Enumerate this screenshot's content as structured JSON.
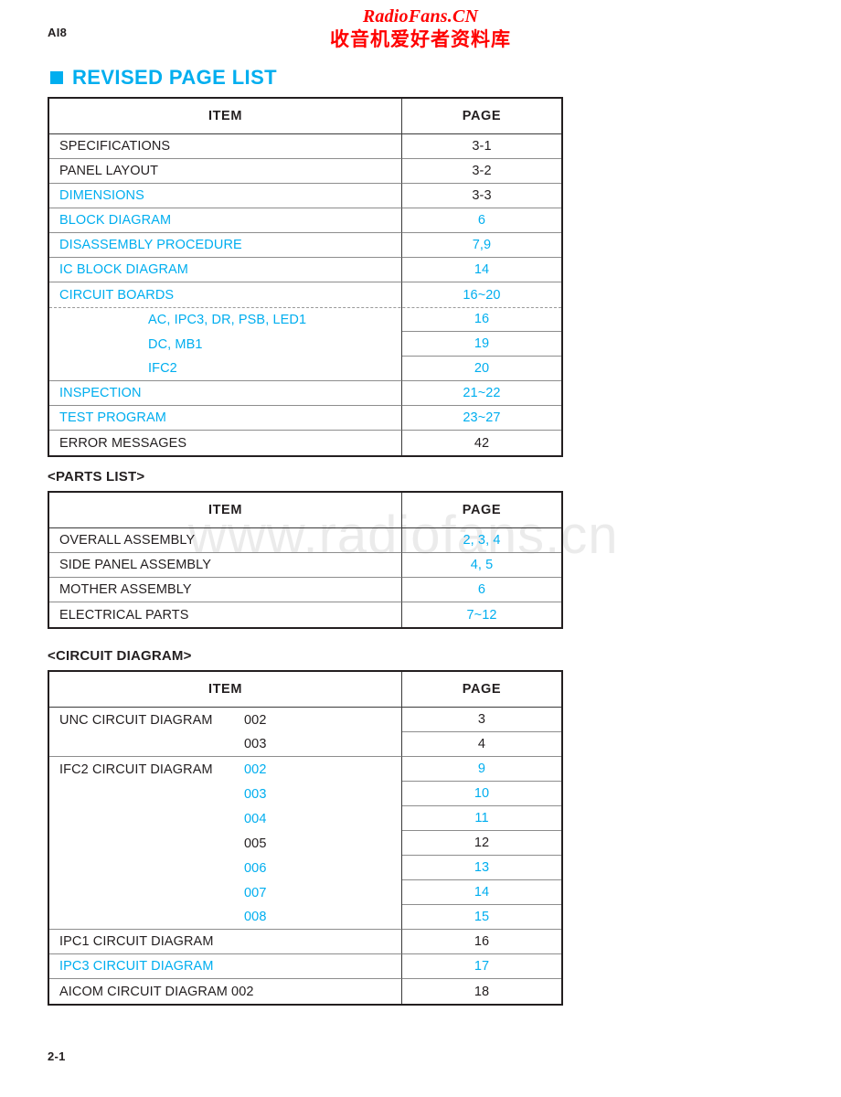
{
  "header": {
    "model_code": "AI8",
    "watermark_latin": "RadioFans.CN",
    "watermark_cjk": "收音机爱好者资料库",
    "body_watermark": "www.radiofans.cn"
  },
  "section": {
    "title": "REVISED PAGE LIST",
    "accent_color": "#00AEEF"
  },
  "footer": {
    "page_number": "2-1"
  },
  "revised_page_list": {
    "columns": [
      "ITEM",
      "PAGE"
    ],
    "rows": [
      {
        "item": "SPECIFICATIONS",
        "page": "3-1",
        "item_color": "black",
        "page_color": "black",
        "indent": false,
        "sep": "full"
      },
      {
        "item": "PANEL LAYOUT",
        "page": "3-2",
        "item_color": "black",
        "page_color": "black",
        "indent": false,
        "sep": "full"
      },
      {
        "item": "DIMENSIONS",
        "page": "3-3",
        "item_color": "blue",
        "page_color": "black",
        "indent": false,
        "sep": "full"
      },
      {
        "item": "BLOCK DIAGRAM",
        "page": "6",
        "item_color": "blue",
        "page_color": "blue",
        "indent": false,
        "sep": "full"
      },
      {
        "item": "DISASSEMBLY PROCEDURE",
        "page": "7,9",
        "item_color": "blue",
        "page_color": "blue",
        "indent": false,
        "sep": "full"
      },
      {
        "item": "IC BLOCK DIAGRAM",
        "page": "14",
        "item_color": "blue",
        "page_color": "blue",
        "indent": false,
        "sep": "full"
      },
      {
        "item": "CIRCUIT BOARDS",
        "page": "16~20",
        "item_color": "blue",
        "page_color": "blue",
        "indent": false,
        "sep": "dashed"
      },
      {
        "item": "AC, IPC3, DR, PSB, LED1",
        "page": "16",
        "item_color": "blue",
        "page_color": "blue",
        "indent": true,
        "sep": "page-only"
      },
      {
        "item": "DC, MB1",
        "page": "19",
        "item_color": "blue",
        "page_color": "blue",
        "indent": true,
        "sep": "page-only"
      },
      {
        "item": "IFC2",
        "page": "20",
        "item_color": "blue",
        "page_color": "blue",
        "indent": true,
        "sep": "full"
      },
      {
        "item": "INSPECTION",
        "page": "21~22",
        "item_color": "blue",
        "page_color": "blue",
        "indent": false,
        "sep": "full"
      },
      {
        "item": "TEST PROGRAM",
        "page": "23~27",
        "item_color": "blue",
        "page_color": "blue",
        "indent": false,
        "sep": "full"
      },
      {
        "item": "ERROR MESSAGES",
        "page": "42",
        "item_color": "black",
        "page_color": "black",
        "indent": false,
        "sep": "none"
      }
    ]
  },
  "parts_list": {
    "heading": "<PARTS LIST>",
    "columns": [
      "ITEM",
      "PAGE"
    ],
    "rows": [
      {
        "item": "OVERALL ASSEMBLY",
        "page": "2, 3, 4",
        "item_color": "black",
        "page_color": "blue",
        "sep": "full"
      },
      {
        "item": "SIDE PANEL ASSEMBLY",
        "page": "4, 5",
        "item_color": "black",
        "page_color": "blue",
        "sep": "full"
      },
      {
        "item": "MOTHER ASSEMBLY",
        "page": "6",
        "item_color": "black",
        "page_color": "blue",
        "sep": "full"
      },
      {
        "item": "ELECTRICAL PARTS",
        "page": "7~12",
        "item_color": "black",
        "page_color": "blue",
        "sep": "none"
      }
    ]
  },
  "circuit_diagram": {
    "heading": "<CIRCUIT DIAGRAM>",
    "columns": [
      "ITEM",
      "PAGE"
    ],
    "rows": [
      {
        "item": "UNC CIRCUIT DIAGRAM",
        "subnum": "002",
        "page": "3",
        "item_color": "black",
        "subnum_color": "black",
        "page_color": "black",
        "sep": "page-only"
      },
      {
        "item": "",
        "subnum": "003",
        "page": "4",
        "item_color": "black",
        "subnum_color": "black",
        "page_color": "black",
        "sep": "full"
      },
      {
        "item": "IFC2 CIRCUIT DIAGRAM",
        "subnum": "002",
        "page": "9",
        "item_color": "black",
        "subnum_color": "blue",
        "page_color": "blue",
        "sep": "page-only"
      },
      {
        "item": "",
        "subnum": "003",
        "page": "10",
        "item_color": "black",
        "subnum_color": "blue",
        "page_color": "blue",
        "sep": "page-only"
      },
      {
        "item": "",
        "subnum": "004",
        "page": "11",
        "item_color": "black",
        "subnum_color": "blue",
        "page_color": "blue",
        "sep": "page-only"
      },
      {
        "item": "",
        "subnum": "005",
        "page": "12",
        "item_color": "black",
        "subnum_color": "black",
        "page_color": "black",
        "sep": "page-only"
      },
      {
        "item": "",
        "subnum": "006",
        "page": "13",
        "item_color": "black",
        "subnum_color": "blue",
        "page_color": "blue",
        "sep": "page-only"
      },
      {
        "item": "",
        "subnum": "007",
        "page": "14",
        "item_color": "black",
        "subnum_color": "blue",
        "page_color": "blue",
        "sep": "page-only"
      },
      {
        "item": "",
        "subnum": "008",
        "page": "15",
        "item_color": "black",
        "subnum_color": "blue",
        "page_color": "blue",
        "sep": "full"
      },
      {
        "item": "IPC1 CIRCUIT DIAGRAM",
        "subnum": "",
        "page": "16",
        "item_color": "black",
        "subnum_color": "black",
        "page_color": "black",
        "sep": "full"
      },
      {
        "item": "IPC3 CIRCUIT DIAGRAM",
        "subnum": "",
        "page": "17",
        "item_color": "blue",
        "subnum_color": "blue",
        "page_color": "blue",
        "sep": "full"
      },
      {
        "item": "AICOM CIRCUIT DIAGRAM  002",
        "subnum": "",
        "page": "18",
        "item_color": "black",
        "subnum_color": "black",
        "page_color": "black",
        "sep": "none"
      }
    ]
  }
}
